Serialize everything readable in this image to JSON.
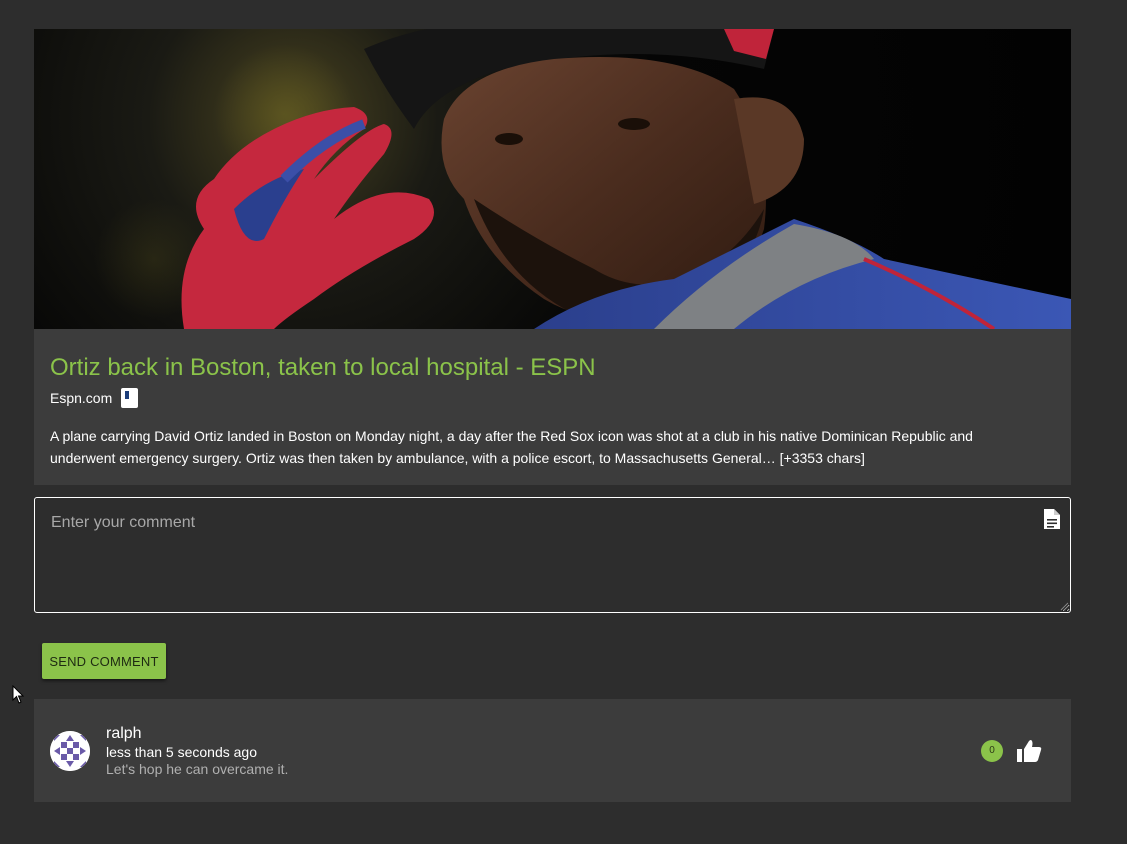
{
  "article": {
    "title": "Ortiz back in Boston, taken to local hospital - ESPN",
    "source": "Espn.com",
    "description": "A plane carrying David Ortiz landed in Boston on Monday night, a day after the Red Sox icon was shot at a club in his native Dominican Republic and underwent emergency surgery. Ortiz was then taken by ambulance, with a police escort, to Massachusetts General… [+3353 chars]"
  },
  "comment_form": {
    "placeholder": "Enter your comment",
    "send_label": "SEND COMMENT"
  },
  "comments": [
    {
      "user": "ralph",
      "time": "less than 5 seconds ago",
      "text": "Let's hop he can overcame it.",
      "likes": "0"
    }
  ],
  "colors": {
    "accent": "#8bc34a",
    "background": "#2d2d2d",
    "card": "#3c3c3c"
  },
  "icons": {
    "source": "favicon-icon",
    "comment_box": "document-icon",
    "like": "thumb-up-icon"
  }
}
